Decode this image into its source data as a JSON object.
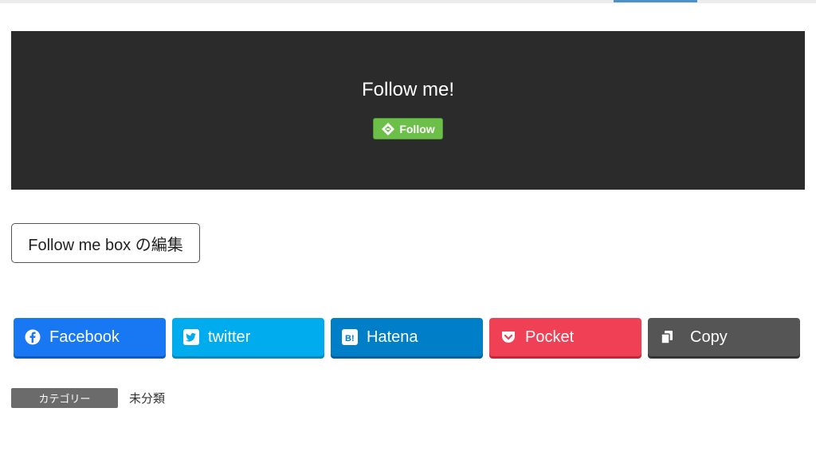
{
  "follow_box": {
    "title": "Follow me!",
    "feedly_button_label": "Follow"
  },
  "edit_button_label": "Follow me box の編集",
  "share_buttons": [
    {
      "label": "Facebook",
      "icon": "facebook-icon",
      "color": "#1877f2",
      "shadow": "#0e5ac0"
    },
    {
      "label": "twitter",
      "icon": "twitter-icon",
      "color": "#00acee",
      "shadow": "#0086ba"
    },
    {
      "label": "Hatena",
      "icon": "hatena-icon",
      "color": "#007fc8",
      "shadow": "#005f96"
    },
    {
      "label": "Pocket",
      "icon": "pocket-icon",
      "color": "#ef4056",
      "shadow": "#c0283c"
    },
    {
      "label": "Copy",
      "icon": "copy-icon",
      "color": "#555555",
      "shadow": "#333333"
    }
  ],
  "category": {
    "label": "カテゴリー",
    "value": "未分類"
  },
  "colors": {
    "follow_box_bg": "#2b2b2b",
    "feedly_green": "#6cc04a",
    "category_bg": "#6b6b6b"
  }
}
